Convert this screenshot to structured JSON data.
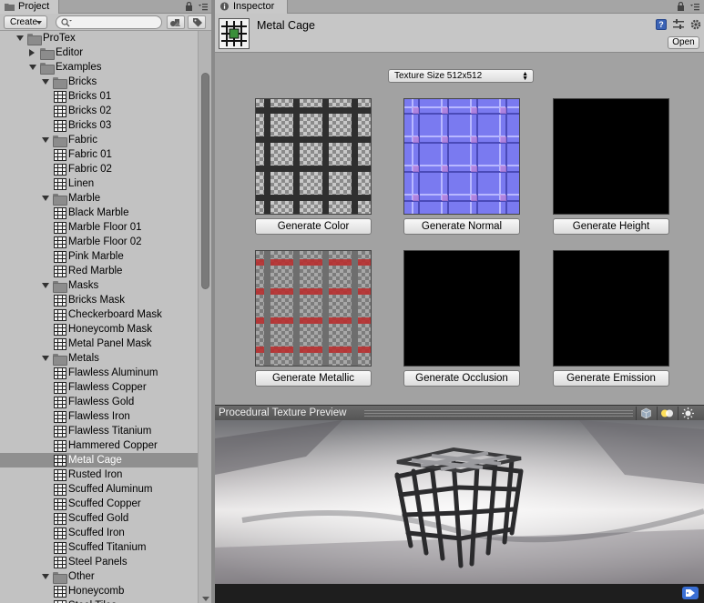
{
  "project_panel": {
    "tab_label": "Project",
    "create_label": "Create",
    "search_placeholder": "",
    "tree": [
      {
        "label": "ProTex",
        "kind": "folder",
        "depth": 0,
        "state": "open"
      },
      {
        "label": "Editor",
        "kind": "folder",
        "depth": 1,
        "state": "closed"
      },
      {
        "label": "Examples",
        "kind": "folder",
        "depth": 1,
        "state": "open"
      },
      {
        "label": "Bricks",
        "kind": "folder",
        "depth": 2,
        "state": "open"
      },
      {
        "label": "Bricks 01",
        "kind": "asset",
        "depth": 3
      },
      {
        "label": "Bricks 02",
        "kind": "asset",
        "depth": 3
      },
      {
        "label": "Bricks 03",
        "kind": "asset",
        "depth": 3
      },
      {
        "label": "Fabric",
        "kind": "folder",
        "depth": 2,
        "state": "open"
      },
      {
        "label": "Fabric 01",
        "kind": "asset",
        "depth": 3
      },
      {
        "label": "Fabric 02",
        "kind": "asset",
        "depth": 3
      },
      {
        "label": "Linen",
        "kind": "asset",
        "depth": 3
      },
      {
        "label": "Marble",
        "kind": "folder",
        "depth": 2,
        "state": "open"
      },
      {
        "label": "Black Marble",
        "kind": "asset",
        "depth": 3
      },
      {
        "label": "Marble Floor 01",
        "kind": "asset",
        "depth": 3
      },
      {
        "label": "Marble Floor 02",
        "kind": "asset",
        "depth": 3
      },
      {
        "label": "Pink Marble",
        "kind": "asset",
        "depth": 3
      },
      {
        "label": "Red Marble",
        "kind": "asset",
        "depth": 3
      },
      {
        "label": "Masks",
        "kind": "folder",
        "depth": 2,
        "state": "open"
      },
      {
        "label": "Bricks Mask",
        "kind": "asset",
        "depth": 3
      },
      {
        "label": "Checkerboard Mask",
        "kind": "asset",
        "depth": 3
      },
      {
        "label": "Honeycomb Mask",
        "kind": "asset",
        "depth": 3
      },
      {
        "label": "Metal Panel Mask",
        "kind": "asset",
        "depth": 3
      },
      {
        "label": "Metals",
        "kind": "folder",
        "depth": 2,
        "state": "open"
      },
      {
        "label": "Flawless Aluminum",
        "kind": "asset",
        "depth": 3
      },
      {
        "label": "Flawless Copper",
        "kind": "asset",
        "depth": 3
      },
      {
        "label": "Flawless Gold",
        "kind": "asset",
        "depth": 3
      },
      {
        "label": "Flawless Iron",
        "kind": "asset",
        "depth": 3
      },
      {
        "label": "Flawless Titanium",
        "kind": "asset",
        "depth": 3
      },
      {
        "label": "Hammered Copper",
        "kind": "asset",
        "depth": 3
      },
      {
        "label": "Metal Cage",
        "kind": "asset",
        "depth": 3,
        "selected": true
      },
      {
        "label": "Rusted Iron",
        "kind": "asset",
        "depth": 3
      },
      {
        "label": "Scuffed Aluminum",
        "kind": "asset",
        "depth": 3
      },
      {
        "label": "Scuffed Copper",
        "kind": "asset",
        "depth": 3
      },
      {
        "label": "Scuffed Gold",
        "kind": "asset",
        "depth": 3
      },
      {
        "label": "Scuffed Iron",
        "kind": "asset",
        "depth": 3
      },
      {
        "label": "Scuffed Titanium",
        "kind": "asset",
        "depth": 3
      },
      {
        "label": "Steel Panels",
        "kind": "asset",
        "depth": 3
      },
      {
        "label": "Other",
        "kind": "folder",
        "depth": 2,
        "state": "open"
      },
      {
        "label": "Honeycomb",
        "kind": "asset",
        "depth": 3
      },
      {
        "label": "Steel Tiles",
        "kind": "asset",
        "depth": 3
      }
    ]
  },
  "inspector": {
    "tab_label": "Inspector",
    "asset_title": "Metal Cage",
    "help_glyph": "?",
    "open_label": "Open",
    "texture_size_label": "Texture Size 512x512",
    "buttons": {
      "color": "Generate Color",
      "normal": "Generate Normal",
      "height": "Generate Height",
      "metallic": "Generate Metallic",
      "occlusion": "Generate Occlusion",
      "emission": "Generate Emission"
    },
    "preview_title": "Procedural Texture Preview"
  },
  "colors": {
    "selection": "#8f8f8f",
    "panel_bg": "#a2a2a2",
    "normal_map": "#7f7fff",
    "metallic_red": "#c83232",
    "label_blue": "#3a6fd4"
  }
}
